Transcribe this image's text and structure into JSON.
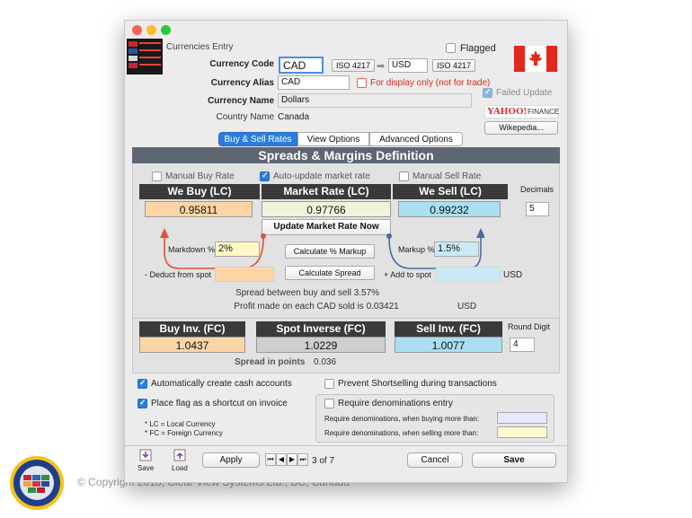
{
  "window": {
    "title": "Currencies Entry"
  },
  "colors": {
    "accent": "#2a7de1",
    "buy": "#fcd5a7",
    "sell": "#a9dff0",
    "market": "#eef5dc",
    "red": "#e03a2a"
  },
  "header": {
    "flagged_label": "Flagged",
    "currency_code_label": "Currency Code",
    "currency_code_value": "CAD",
    "iso_button_1": "ISO 4217",
    "base_currency": "USD",
    "iso_button_2": "ISO 4217",
    "currency_alias_label": "Currency Alias",
    "currency_alias_value": "CAD",
    "display_only_label": "For display only (not for trade)",
    "failed_update_label": "Failed Update",
    "currency_name_label": "Currency Name",
    "currency_name_value": "Dollars",
    "country_name_label": "Country Name",
    "country_name_value": "Canada",
    "yahoo_text": "YAHOO!",
    "finance_text": "FINANCE",
    "wikipedia_button": "Wikepedia..."
  },
  "tabs": [
    {
      "label": "Buy & Sell Rates",
      "active": true
    },
    {
      "label": "View Options",
      "active": false
    },
    {
      "label": "Advanced Options",
      "active": false
    }
  ],
  "section_title": "Spreads & Margins Definition",
  "rates": {
    "manual_buy_label": "Manual Buy Rate",
    "auto_update_label": "Auto-update market rate",
    "manual_sell_label": "Manual Sell Rate",
    "we_buy_header": "We Buy (LC)",
    "market_header": "Market Rate (LC)",
    "we_sell_header": "We Sell (LC)",
    "decimals_label": "Decimals",
    "we_buy_value": "0.95811",
    "market_value": "0.97766",
    "we_sell_value": "0.99232",
    "decimals_value": "5",
    "update_button": "Update Market Rate Now",
    "markdown_label": "Markdown %",
    "markdown_value": "2%",
    "calc_markup_button": "Calculate % Markup",
    "markup_label": "Markup %",
    "markup_value": "1.5%",
    "deduct_label": "- Deduct from spot",
    "calc_spread_button": "Calculate Spread",
    "add_label": "+ Add to spot",
    "add_unit": "USD",
    "spread_text": "Spread between buy and sell 3.57%",
    "profit_text": "Profit made on each CAD sold is 0.03421",
    "profit_unit": "USD"
  },
  "inverse": {
    "buy_inv_header": "Buy Inv. (FC)",
    "spot_inv_header": "Spot Inverse (FC)",
    "sell_inv_header": "Sell Inv. (FC)",
    "round_digit_label": "Round Digit",
    "buy_inv_value": "1.0437",
    "spot_inv_value": "1.0229",
    "sell_inv_value": "1.0077",
    "round_digit_value": "4",
    "spread_points_label": "Spread in points",
    "spread_points_value": "0.036"
  },
  "options": {
    "auto_cash_label": "Automatically create cash accounts",
    "prevent_short_label": "Prevent Shortselling during transactions",
    "place_flag_label": "Place flag as a shortcut on invoice",
    "require_denoms_label": "Require denominations entry",
    "lc_note": "* LC = Local Currency",
    "fc_note": "* FC = Foreign Currency",
    "denoms_buying_label": "Require denominations, when buying more than:",
    "denoms_selling_label": "Require denominations, when selling more than:"
  },
  "footer": {
    "save_label": "Save",
    "load_label": "Load",
    "apply_button": "Apply",
    "record_position": "3 of 7",
    "cancel_button": "Cancel",
    "save_button": "Save"
  },
  "copyright": "© Copyright 2018, Clear View Systems Ltd., BC, Canada"
}
